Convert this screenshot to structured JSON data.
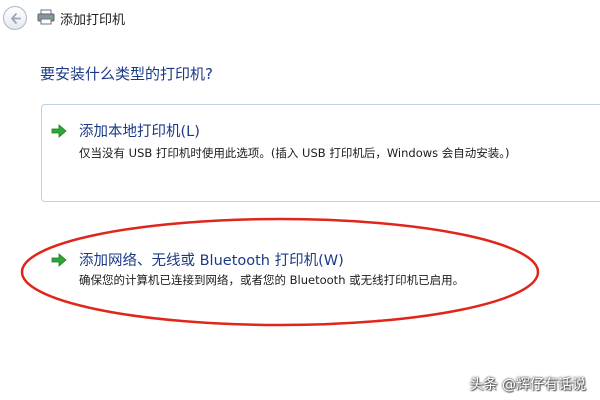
{
  "window": {
    "title": "添加打印机",
    "icons": {
      "back": "back-arrow-icon",
      "app": "printer-icon"
    }
  },
  "main": {
    "heading": "要安装什么类型的打印机?",
    "options": [
      {
        "title": "添加本地打印机(L)",
        "description": "仅当没有 USB 打印机时使用此选项。(插入 USB 打印机后，Windows 会自动安装。)",
        "icon": "green-arrow-icon"
      },
      {
        "title": "添加网络、无线或 Bluetooth 打印机(W)",
        "description": "确保您的计算机已连接到网络，或者您的 Bluetooth 或无线打印机已启用。",
        "icon": "green-arrow-icon"
      }
    ]
  },
  "annotation": {
    "shape": "ellipse",
    "color": "#e0261b"
  },
  "watermark": "头条 @辉仔有话说",
  "colors": {
    "heading": "#1b3a86",
    "option_border": "#b7d4ec",
    "arrow": "#2ea836"
  }
}
